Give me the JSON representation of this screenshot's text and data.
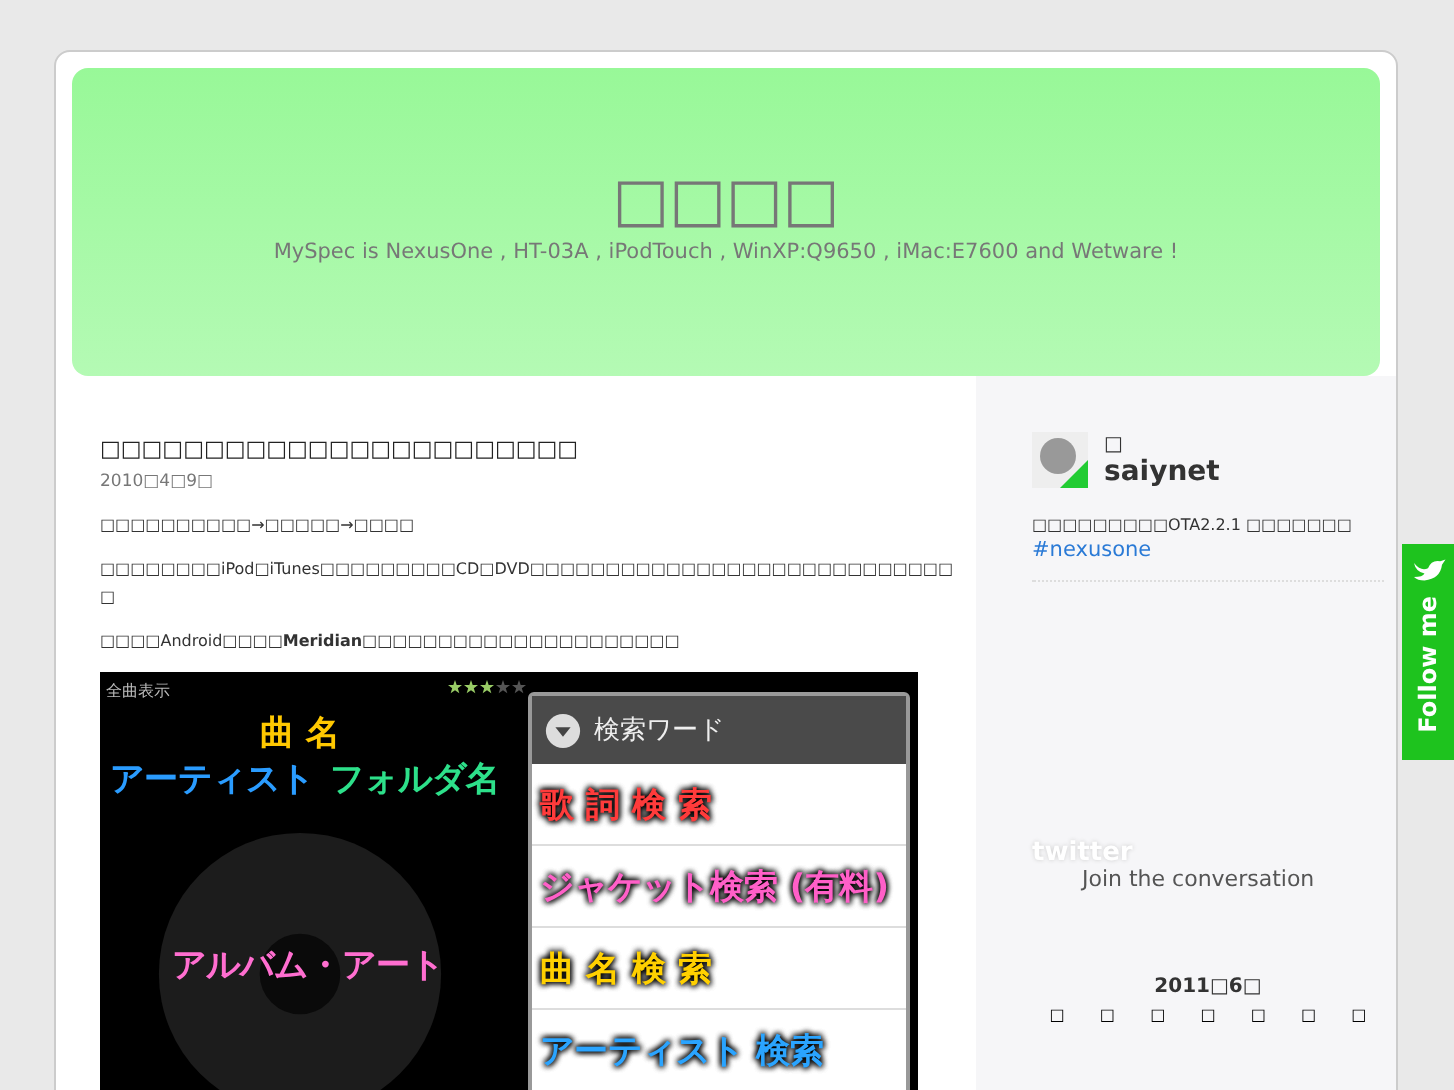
{
  "header": {
    "title": "□□□□",
    "tagline": "MySpec is NexusOne , HT-03A , iPodTouch , WinXP:Q9650 , iMac:E7600 and Wetware !"
  },
  "post": {
    "title": "□□□□□□□□□□□□□□□□□□□□□□□",
    "date": "2010□4□9□",
    "paragraphs": [
      "□□□□□□□□□□→□□□□□→□□□□",
      "□□□□□□□□iPod□iTunes□□□□□□□□□CD□DVD□□□□□□□□□□□□□□□□□□□□□□□□□□□□□",
      "□□□□Android□□□□**Meridian**□□□□□□□□□□□□□□□□□□□□□"
    ],
    "screenshot": {
      "mode": "全曲表示",
      "stars": 3,
      "song": "曲 名",
      "artist": "アーティスト",
      "folder": "フォルダ名",
      "album": "アルバム・アート",
      "dialog_title": "検索ワード",
      "options": [
        {
          "label": "歌 詞 検 索",
          "color": "#ff3b3b"
        },
        {
          "label": "ジャケット検索 (有料)",
          "color": "#ff5fc8"
        },
        {
          "label": "曲 名 検 索",
          "color": "#ffd000"
        },
        {
          "label": "アーティスト 検索",
          "color": "#2aa4ff"
        }
      ]
    }
  },
  "sidebar": {
    "tweet": {
      "name_prefix": "□",
      "user": "saiynet",
      "text": "□□□□□□□□□OTA2.2.1 □□□□□□□",
      "hashtag": "#nexusone"
    },
    "twitter_logo": "twitter",
    "join": "Join the conversation",
    "calendar": {
      "month": "2011□6□",
      "weekdays": [
        "□",
        "□",
        "□",
        "□",
        "□",
        "□",
        "□"
      ]
    }
  },
  "follow_tab": "Follow me"
}
